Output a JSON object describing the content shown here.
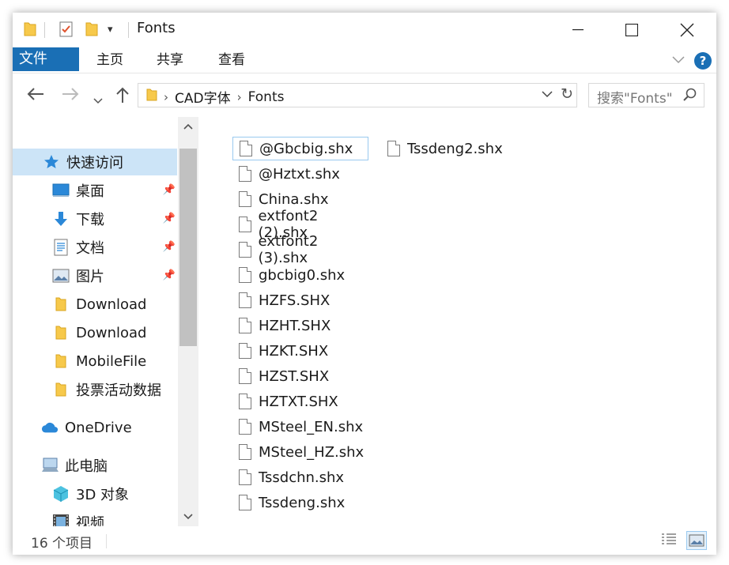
{
  "window": {
    "title": "Fonts"
  },
  "ribbon": {
    "tabs": [
      "文件",
      "主页",
      "共享",
      "查看"
    ],
    "help": "?"
  },
  "address": {
    "crumbs": [
      "CAD字体",
      "Fonts"
    ],
    "search_placeholder": "搜索\"Fonts\""
  },
  "nav": {
    "items": [
      {
        "label": "快速访问",
        "icon": "star-icon",
        "pinned": false
      },
      {
        "label": "桌面",
        "icon": "desktop-icon",
        "pinned": true
      },
      {
        "label": "下载",
        "icon": "download-arrow-icon",
        "pinned": true
      },
      {
        "label": "文档",
        "icon": "document-icon",
        "pinned": true
      },
      {
        "label": "图片",
        "icon": "picture-icon",
        "pinned": true
      },
      {
        "label": "Download",
        "icon": "folder-icon",
        "pinned": false
      },
      {
        "label": "Download",
        "icon": "folder-icon",
        "pinned": false
      },
      {
        "label": "MobileFile",
        "icon": "folder-icon",
        "pinned": false
      },
      {
        "label": "投票活动数据",
        "icon": "folder-icon",
        "pinned": false
      },
      {
        "label": "OneDrive",
        "icon": "cloud-icon",
        "pinned": false
      },
      {
        "label": "此电脑",
        "icon": "computer-icon",
        "pinned": false
      },
      {
        "label": "3D 对象",
        "icon": "cube-icon",
        "pinned": false
      },
      {
        "label": "视频",
        "icon": "film-icon",
        "pinned": false
      }
    ]
  },
  "files": {
    "column1": [
      "@Gbcbig.shx",
      "@Hztxt.shx",
      "China.shx",
      "extfont2 (2).shx",
      "extfont2 (3).shx",
      "gbcbig0.shx",
      "HZFS.SHX",
      "HZHT.SHX",
      "HZKT.SHX",
      "HZST.SHX",
      "HZTXT.SHX",
      "MSteel_EN.shx",
      "MSteel_HZ.shx",
      "Tssdchn.shx",
      "Tssdeng.shx"
    ],
    "column2": [
      "Tssdeng2.shx"
    ]
  },
  "status": {
    "count": "16 个项目"
  },
  "colors": {
    "accent": "#1a6fb5",
    "selected": "#cce4f7",
    "folder": "#f7c94b"
  }
}
